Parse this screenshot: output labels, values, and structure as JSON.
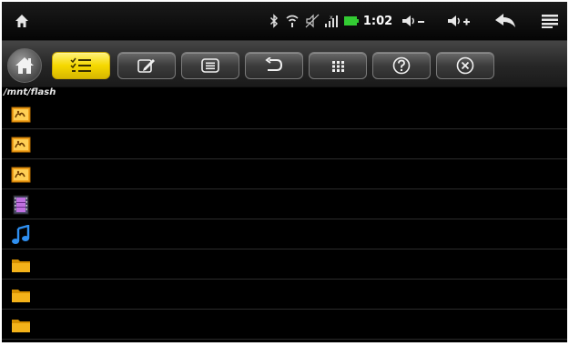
{
  "status_bar": {
    "time": "1:02",
    "left_icon": "home-status-icon",
    "icons": [
      "bluetooth-icon",
      "wifi-icon",
      "sound-muted-icon",
      "signal-icon",
      "battery-icon"
    ],
    "right_icons": [
      "volume-down-icon",
      "volume-up-icon",
      "back-icon",
      "menu-icon"
    ]
  },
  "toolbar": {
    "buttons": [
      "home-icon",
      "multi-select-icon",
      "edit-icon",
      "list-view-icon",
      "undo-icon",
      "grid-view-icon",
      "help-icon",
      "close-icon"
    ],
    "active_button": "multi-select-icon",
    "accent_color": "#f5d800"
  },
  "path": "/mnt/flash",
  "files": [
    {
      "type": "image",
      "icon": "image-file-icon"
    },
    {
      "type": "image",
      "icon": "image-file-icon"
    },
    {
      "type": "image",
      "icon": "image-file-icon"
    },
    {
      "type": "video",
      "icon": "video-file-icon"
    },
    {
      "type": "audio",
      "icon": "music-file-icon"
    },
    {
      "type": "folder",
      "icon": "folder-icon"
    },
    {
      "type": "folder",
      "icon": "folder-icon"
    },
    {
      "type": "folder",
      "icon": "folder-icon"
    }
  ],
  "colors": {
    "folder": "#f3b21a",
    "battery": "#33cc33",
    "music": "#2f8ff0"
  }
}
